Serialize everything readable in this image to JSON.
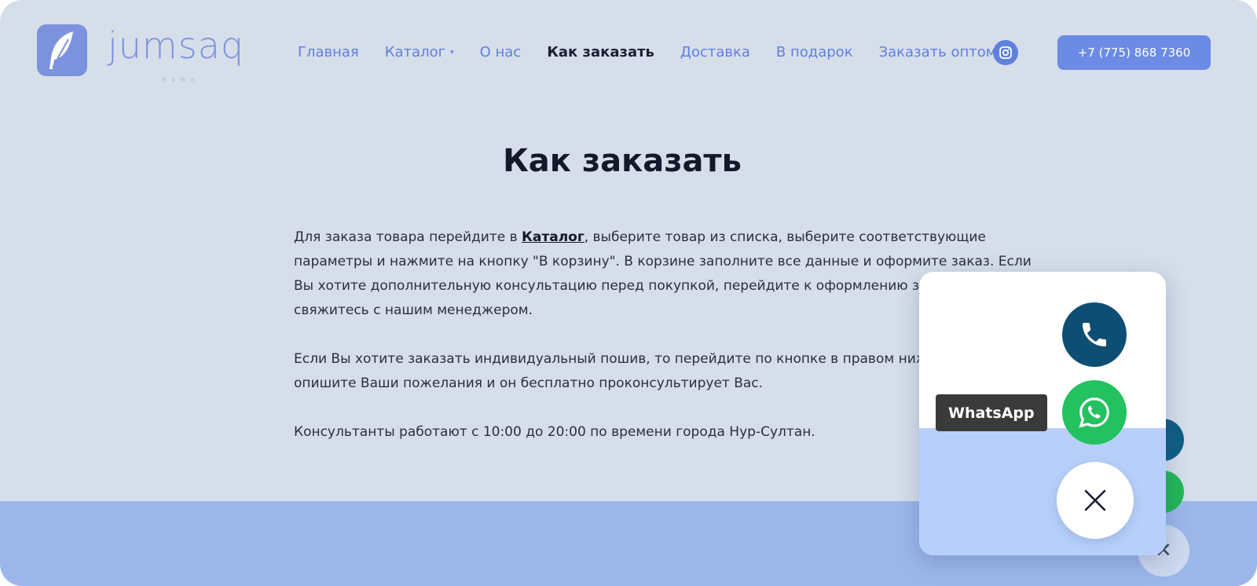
{
  "logo": {
    "word": "jumsaq",
    "sub": "home"
  },
  "nav": {
    "items": [
      {
        "label": "Главная"
      },
      {
        "label": "Каталог"
      },
      {
        "label": "О нас"
      },
      {
        "label": "Как заказать"
      },
      {
        "label": "Доставка"
      },
      {
        "label": "В подарок"
      },
      {
        "label": "Заказать оптом"
      }
    ],
    "catalog_caret": "▾"
  },
  "header": {
    "phone": "+7 (775) 868 7360"
  },
  "page": {
    "title": "Как заказать",
    "p1_before": "Для заказа товара перейдите в ",
    "p1_link": "Каталог",
    "p1_after": ", выберите товар из списка, выберите соответствующие параметры и нажмите на кнопку \"В корзину\". В корзине заполните все данные и оформите заказ. Если Вы хотите дополнительную консультацию перед покупкой, перейдите к оформлению заказа и свяжитесь с нашим менеджером.",
    "p2": "Если Вы хотите заказать индивидуальный пошив, то перейдите по кнопке в правом нижнем углу, опишите Ваши пожелания и он бесплатно проконсультирует Вас.",
    "p3": "Консультанты работают с 10:00 до 20:00 по времени города Нур-Султан."
  },
  "widget": {
    "tooltip": "WhatsApp"
  },
  "colors": {
    "accent": "#6b8be4",
    "call": "#0f4e73",
    "whatsapp": "#23c15f",
    "background": "#d6deea"
  },
  "icons": [
    "feather-icon",
    "instagram-icon",
    "phone-icon",
    "whatsapp-icon",
    "close-icon"
  ]
}
